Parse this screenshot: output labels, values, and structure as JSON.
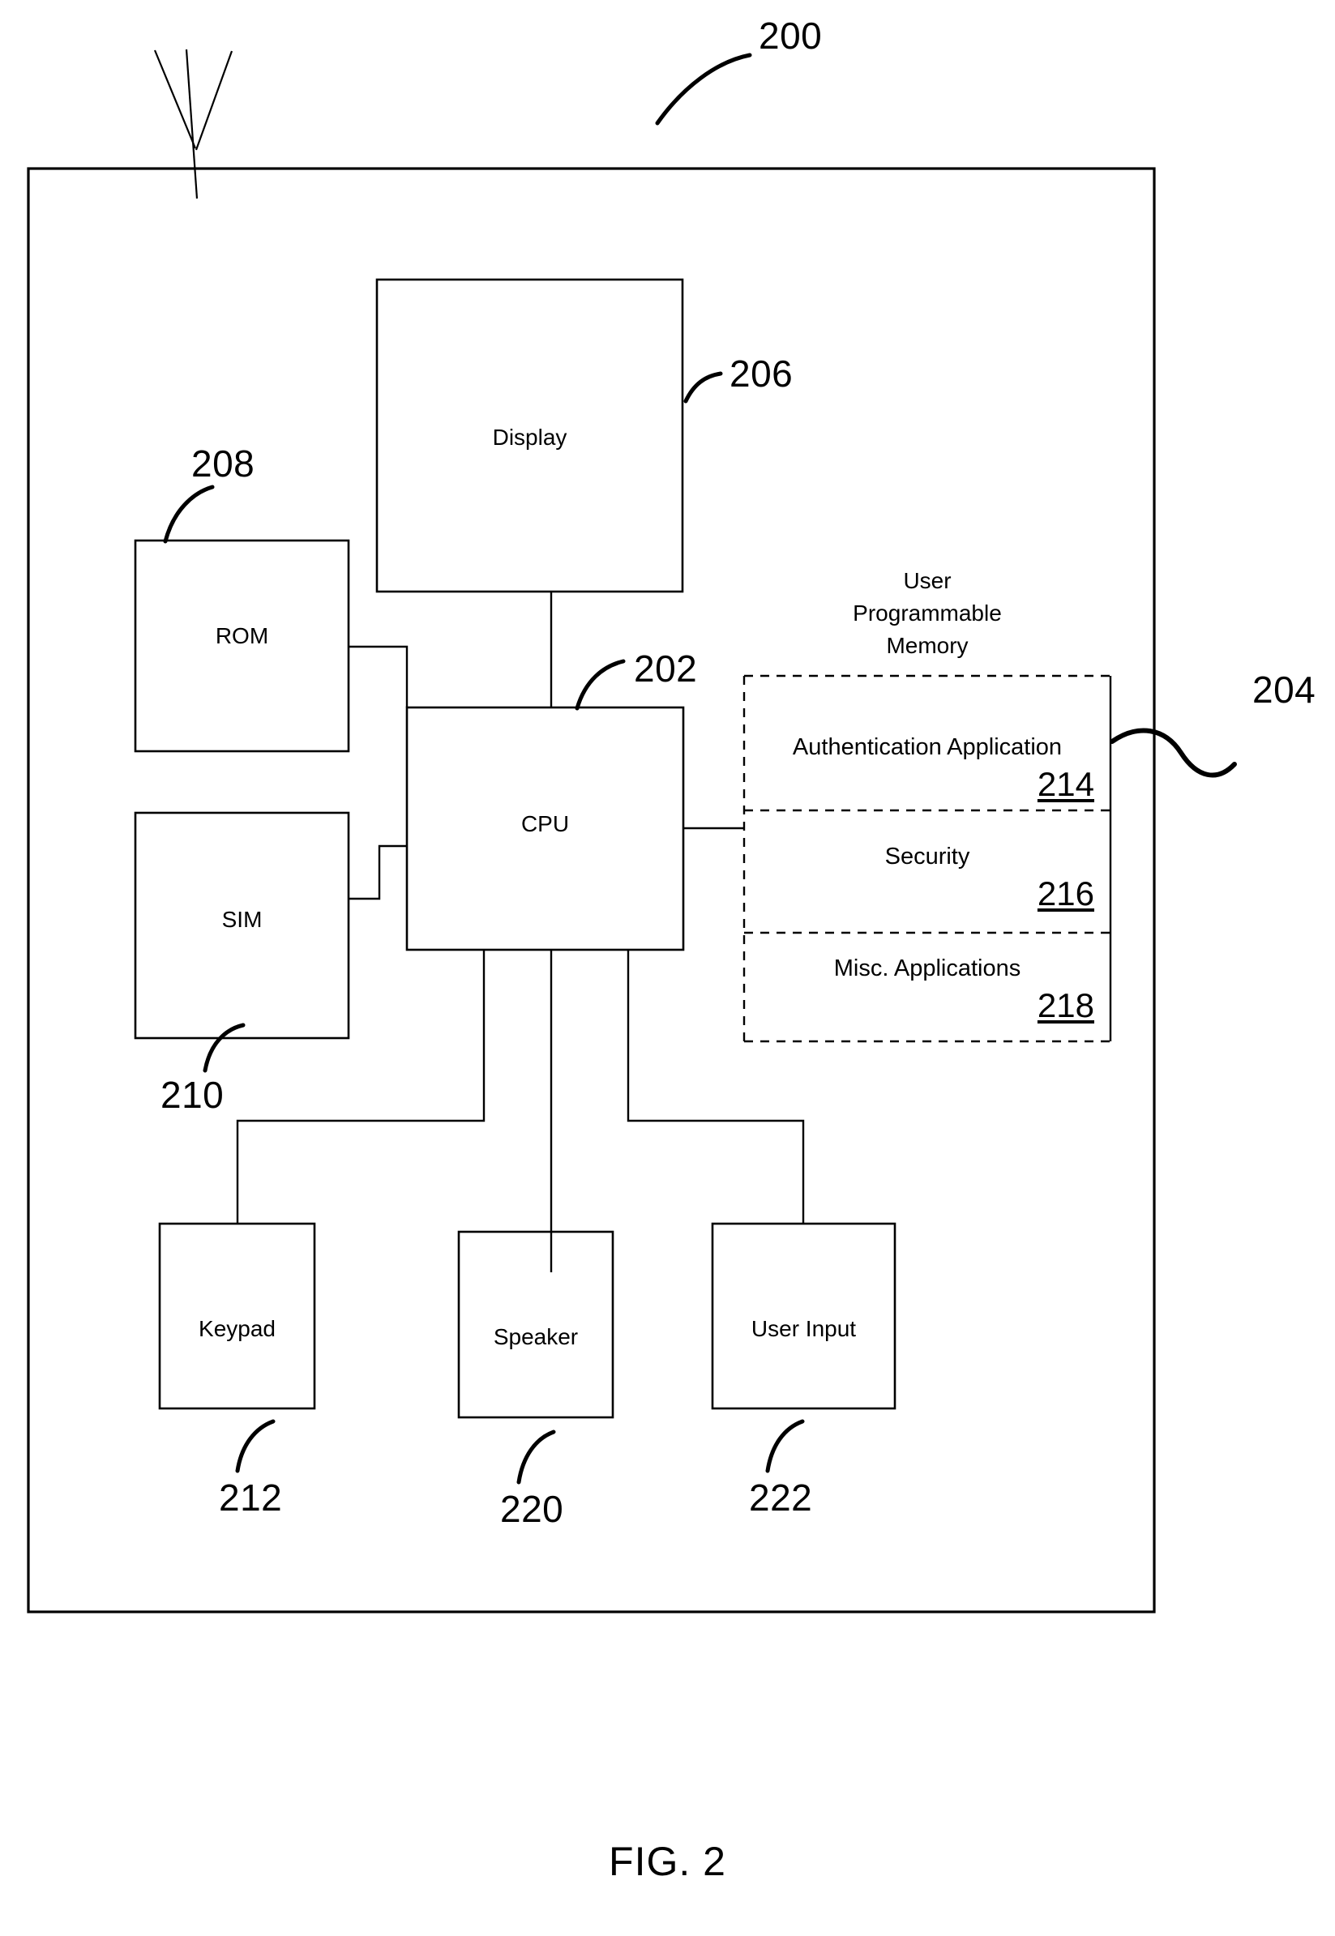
{
  "figure": {
    "caption": "FIG. 2",
    "device_ref": "200"
  },
  "blocks": {
    "display": {
      "label": "Display",
      "ref": "206"
    },
    "rom": {
      "label": "ROM",
      "ref": "208"
    },
    "sim": {
      "label": "SIM",
      "ref": "210"
    },
    "cpu": {
      "label": "CPU",
      "ref": "202"
    },
    "keypad": {
      "label": "Keypad",
      "ref": "212"
    },
    "speaker": {
      "label": "Speaker",
      "ref": "220"
    },
    "user_input": {
      "label": "User Input",
      "ref": "222"
    }
  },
  "memory": {
    "title_line1": "User",
    "title_line2": "Programmable",
    "title_line3": "Memory",
    "ref": "204",
    "sections": [
      {
        "label": "Authentication Application",
        "ref": "214"
      },
      {
        "label": "Security",
        "ref": "216"
      },
      {
        "label": "Misc. Applications",
        "ref": "218"
      }
    ]
  },
  "icons": {
    "antenna": "antenna-icon"
  },
  "colors": {
    "stroke": "#000000",
    "background": "#ffffff"
  }
}
